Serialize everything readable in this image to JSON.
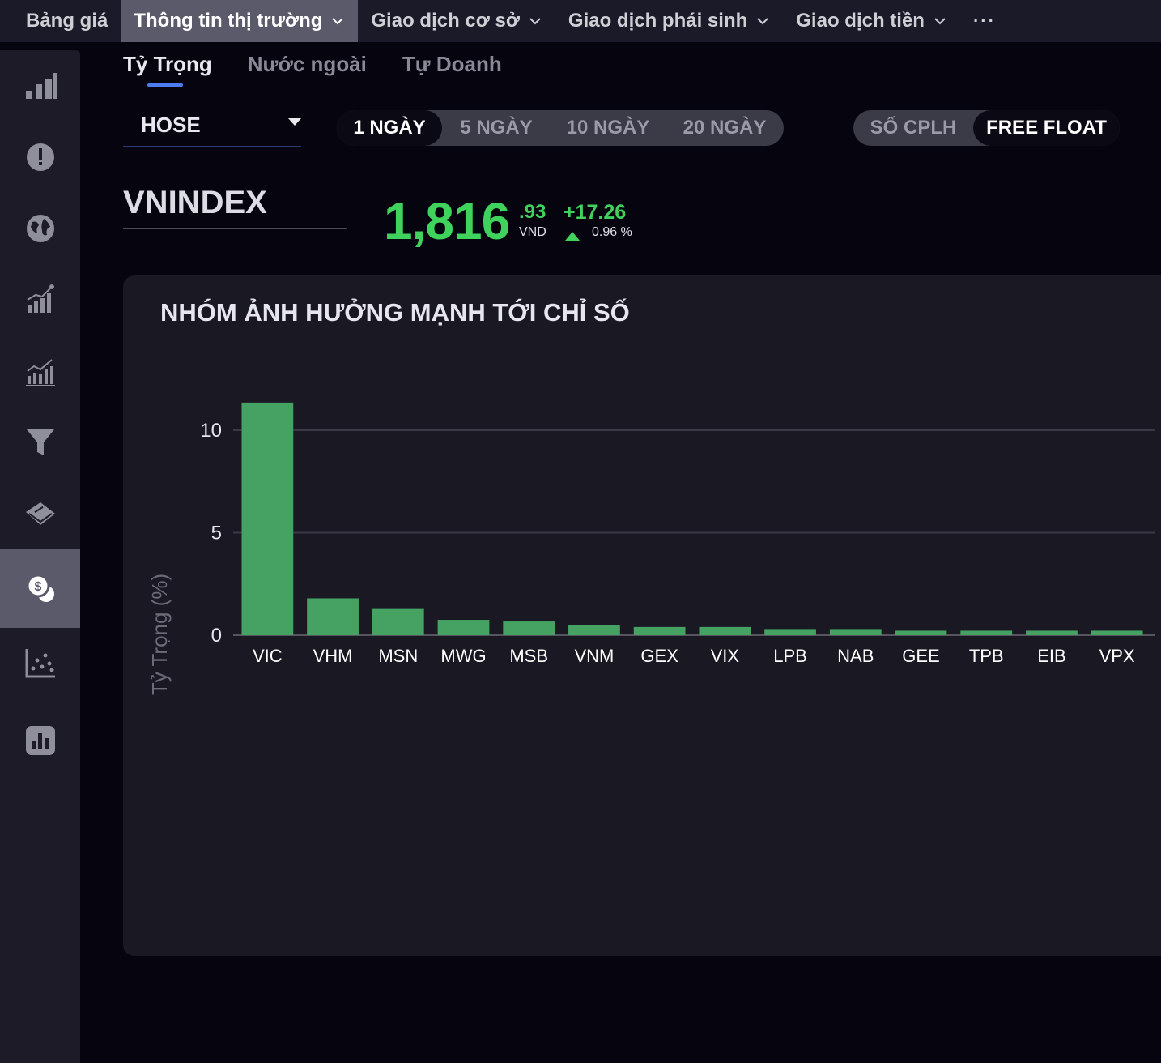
{
  "topnav": {
    "items": [
      {
        "label": "Bảng giá",
        "has_dropdown": false,
        "active": false
      },
      {
        "label": "Thông tin thị trường",
        "has_dropdown": true,
        "active": true
      },
      {
        "label": "Giao dịch cơ sở",
        "has_dropdown": true,
        "active": false
      },
      {
        "label": "Giao dịch phái sinh",
        "has_dropdown": true,
        "active": false
      },
      {
        "label": "Giao dịch tiền",
        "has_dropdown": true,
        "active": false
      }
    ],
    "more": "···"
  },
  "sidebar": {
    "items": [
      {
        "icon": "bar-chart-icon"
      },
      {
        "icon": "alert-icon"
      },
      {
        "icon": "globe-icon"
      },
      {
        "icon": "chart-up-icon"
      },
      {
        "icon": "trend-chart-icon"
      },
      {
        "icon": "filter-icon"
      },
      {
        "icon": "book-icon"
      },
      {
        "icon": "coins-icon",
        "active": true
      },
      {
        "icon": "scatter-icon"
      },
      {
        "icon": "report-icon"
      }
    ]
  },
  "subtabs": [
    "Tỷ Trọng",
    "Nước ngoài",
    "Tự Doanh"
  ],
  "exchange": {
    "selected": "HOSE"
  },
  "periods": [
    "1 NGÀY",
    "5 NGÀY",
    "10 NGÀY",
    "20 NGÀY"
  ],
  "weight_modes": [
    "SỐ CPLH",
    "FREE FLOAT"
  ],
  "index": {
    "name": "VNINDEX",
    "value_int": "1,816",
    "value_dec": ".93",
    "currency": "VND",
    "change": "+17.26",
    "change_pct": "0.96 %",
    "direction": "up"
  },
  "colors": {
    "up": "#3fd25c",
    "bar": "#45a262",
    "accent": "#4c7cf0"
  },
  "chart_data": {
    "type": "bar",
    "title": "NHÓM ẢNH HƯỞNG MẠNH TỚI CHỈ SỐ",
    "ylabel": "Tỷ Trọng (%)",
    "xlabel": "",
    "categories": [
      "VIC",
      "VHM",
      "MSN",
      "MWG",
      "MSB",
      "VNM",
      "GEX",
      "VIX",
      "LPB",
      "NAB",
      "GEE",
      "TPB",
      "EIB",
      "VPX"
    ],
    "values": [
      11.35,
      1.8,
      1.28,
      0.75,
      0.67,
      0.5,
      0.4,
      0.4,
      0.3,
      0.3,
      0.22,
      0.22,
      0.22,
      0.22
    ],
    "ylim": [
      -10,
      10
    ],
    "yticks": [
      10,
      5,
      0,
      -5,
      -10
    ],
    "grid": true,
    "legend": "none"
  }
}
